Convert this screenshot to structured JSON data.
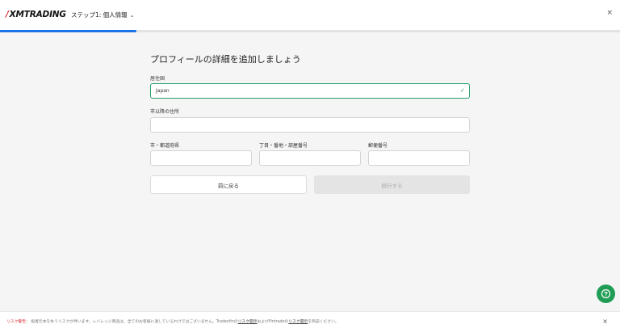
{
  "header": {
    "logo_slash": "/",
    "logo_text": "XMTRADING",
    "step_label": "ステップ1: 個人情報",
    "chevron": "⌄",
    "close": "×"
  },
  "progress": {
    "fraction": 0.22,
    "color": "#1a73e8"
  },
  "form": {
    "title": "プロフィールの詳細を追加しましょう",
    "residence_label": "居住国",
    "residence_value": "Japan",
    "address_label": "市以降の住所",
    "address_value": "",
    "city_label": "市・都道府県",
    "city_value": "",
    "block_label": "丁目・番地・部屋番号",
    "block_value": "",
    "postal_label": "郵便番号",
    "postal_value": "",
    "back_button": "前に戻る",
    "next_button": "続行する"
  },
  "footer": {
    "warning_label": "リスク警告",
    "text_1": "： 投資元本を失うリスクが伴います。レバレッジ商品は、全てのお客様に適しているわけではございません。Tradexfinの",
    "link_1": "リスク開示",
    "text_2": "およびFintradeの",
    "link_2": "リスク開示",
    "text_3": "を熟読ください。",
    "close": "×"
  },
  "colors": {
    "accent": "#1a73e8",
    "valid": "#22a06b",
    "brand_red": "#d9232e",
    "help_green": "#1f9d55"
  },
  "icons": {
    "help": "chat-help-icon",
    "check": "checkmark-icon"
  }
}
